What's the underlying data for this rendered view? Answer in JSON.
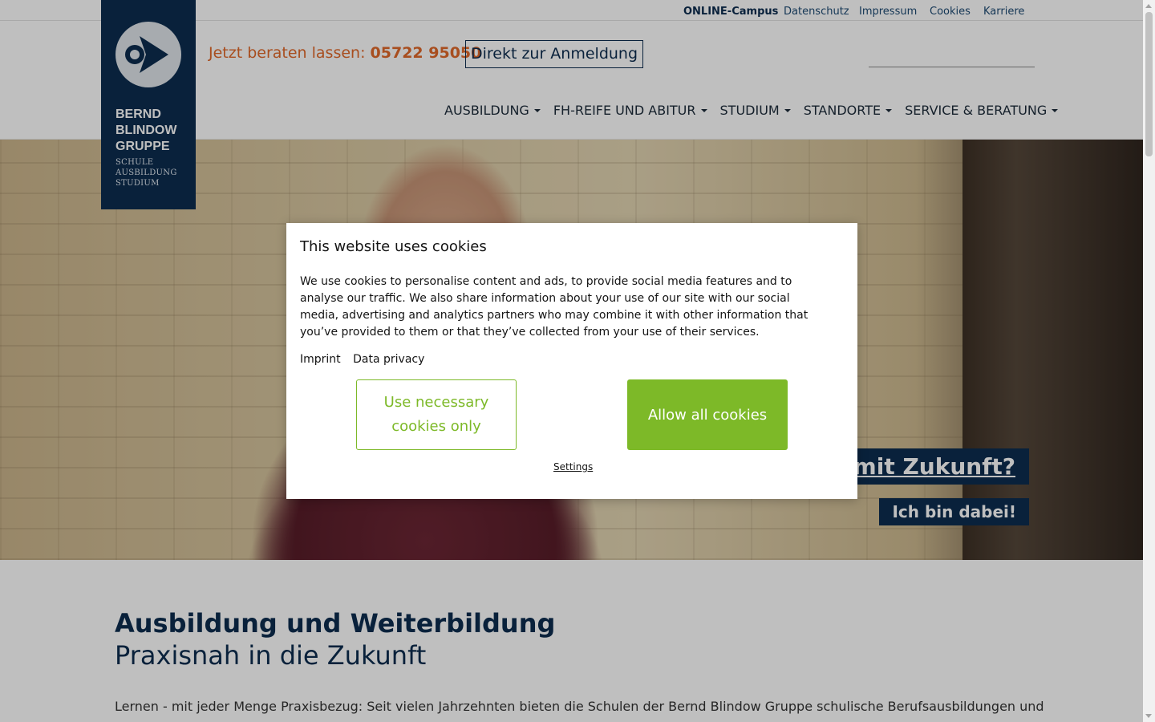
{
  "topbar": {
    "links": [
      "ONLINE-Campus",
      "Datenschutz",
      "Impressum",
      "Cookies",
      "Karriere"
    ]
  },
  "logo": {
    "name_lines": [
      "BERND",
      "BLINDOW",
      "GRUPPE"
    ],
    "sub_lines": [
      "SCHULE",
      "AUSBILDUNG",
      "STUDIUM"
    ]
  },
  "header": {
    "hotline_label": "Jetzt beraten lassen:",
    "hotline_number": "05722 95050",
    "register_button": "Direkt zur Anmeldung"
  },
  "nav": {
    "items": [
      "AUSBILDUNG",
      "FH-REIFE UND ABITUR",
      "STUDIUM",
      "STANDORTE",
      "SERVICE & BERATUNG"
    ]
  },
  "hero": {
    "title": "g mit Zukunft?",
    "cta": "Ich bin dabei!"
  },
  "content": {
    "heading": "Ausbildung und Weiterbildung",
    "subheading": "Praxisnah in die Zukunft",
    "paragraph": "Lernen - mit jeder Menge Praxisbezug: Seit vielen Jahrzehnten bieten die Schulen der Bernd Blindow Gruppe schulische Berufsausbildungen und"
  },
  "cookie_dialog": {
    "title": "This website uses cookies",
    "text": "We use cookies to personalise content and ads, to provide social media features and to analyse our traffic. We also share information about your use of our site with our social media, advertising and analytics partners who may combine it with other information that you’ve provided to them or that they’ve collected from your use of their services.",
    "links": [
      "Imprint",
      "Data privacy"
    ],
    "necessary_button": "Use necessary cookies only",
    "allow_button": "Allow all cookies",
    "settings_link": "Settings"
  },
  "colors": {
    "brand_navy": "#0d2d4f",
    "hotline_orange": "#e0682a",
    "cookie_green": "#7db928"
  }
}
